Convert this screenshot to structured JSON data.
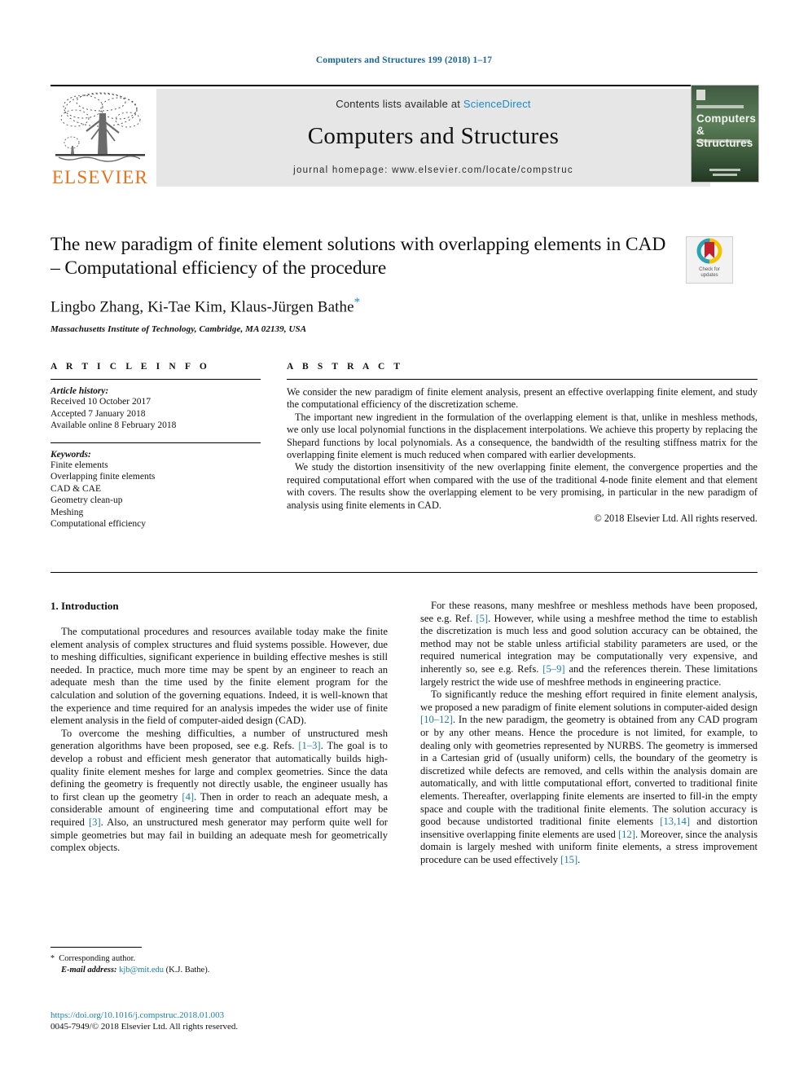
{
  "running_head": "Computers and Structures 199 (2018) 1–17",
  "masthead": {
    "contents_prefix": "Contents lists available at ",
    "sciencedirect": "ScienceDirect",
    "journal_title": "Computers and Structures",
    "homepage": "journal homepage: www.elsevier.com/locate/compstruc",
    "publisher_logo_text": "ELSEVIER",
    "cover": {
      "line1": "Computers",
      "line2": "& Structures"
    }
  },
  "title_block": {
    "title": "The new paradigm of finite element solutions with overlapping elements in CAD – Computational efficiency of the procedure",
    "authors": "Lingbo Zhang, Ki-Tae Kim, Klaus-Jürgen Bathe",
    "corresponding_marker": "*",
    "affiliation": "Massachusetts Institute of Technology, Cambridge, MA 02139, USA",
    "crossmark_label_line1": "Check for",
    "crossmark_label_line2": "updates"
  },
  "article_info": {
    "heading": "A R T I C L E   I N F O",
    "history_label": "Article history:",
    "history": [
      "Received 10 October 2017",
      "Accepted 7 January 2018",
      "Available online 8 February 2018"
    ],
    "keywords_label": "Keywords:",
    "keywords": [
      "Finite elements",
      "Overlapping finite elements",
      "CAD & CAE",
      "Geometry clean-up",
      "Meshing",
      "Computational efficiency"
    ]
  },
  "abstract": {
    "heading": "A B S T R A C T",
    "paragraphs": [
      "We consider the new paradigm of finite element analysis, present an effective overlapping finite element, and study the computational efficiency of the discretization scheme.",
      "The important new ingredient in the formulation of the overlapping element is that, unlike in meshless methods, we only use local polynomial functions in the displacement interpolations. We achieve this property by replacing the Shepard functions by local polynomials. As a consequence, the bandwidth of the resulting stiffness matrix for the overlapping finite element is much reduced when compared with earlier developments.",
      "We study the distortion insensitivity of the new overlapping finite element, the convergence properties and the required computational effort when compared with the use of the traditional 4-node finite element and that element with covers. The results show the overlapping element to be very promising, in particular in the new paradigm of analysis using finite elements in CAD."
    ],
    "copyright": "© 2018 Elsevier Ltd. All rights reserved."
  },
  "body": {
    "section_heading": "1. Introduction",
    "left_paragraphs": [
      "The computational procedures and resources available today make the finite element analysis of complex structures and fluid systems possible. However, due to meshing difficulties, significant experience in building effective meshes is still needed. In practice, much more time may be spent by an engineer to reach an adequate mesh than the time used by the finite element program for the calculation and solution of the governing equations. Indeed, it is well-known that the experience and time required for an analysis impedes the wider use of finite element analysis in the field of computer-aided design (CAD)."
    ],
    "left_paragraph_2_parts": [
      "To overcome the meshing difficulties, a number of unstructured mesh generation algorithms have been proposed, see e.g. Refs. ",
      "[1–3]",
      ". The goal is to develop a robust and efficient mesh generator that automatically builds high-quality finite element meshes for large and complex geometries. Since the data defining the geometry is frequently not directly usable, the engineer usually has to first clean up the geometry ",
      "[4]",
      ". Then in order to reach an adequate mesh, a considerable amount of engineering time and computational effort may be required ",
      "[3]",
      ". Also, an unstructured mesh generator may perform quite well for simple geometries but may fail in building an adequate mesh for geometrically complex objects."
    ],
    "right_paragraph_1_parts": [
      "For these reasons, many meshfree or meshless methods have been proposed, see e.g. Ref. ",
      "[5]",
      ". However, while using a meshfree method the time to establish the discretization is much less and good solution accuracy can be obtained, the method may not be stable unless artificial stability parameters are used, or the required numerical integration may be computationally very expensive, and inherently so, see e.g. Refs. ",
      "[5–9]",
      " and the references therein. These limitations largely restrict the wide use of meshfree methods in engineering practice."
    ],
    "right_paragraph_2_parts": [
      "To significantly reduce the meshing effort required in finite element analysis, we proposed a new paradigm of finite element solutions in computer-aided design ",
      "[10–12]",
      ". In the new paradigm, the geometry is obtained from any CAD program or by any other means. Hence the procedure is not limited, for example, to dealing only with geometries represented by NURBS. The geometry is immersed in a Cartesian grid of (usually uniform) cells, the boundary of the geometry is discretized while defects are removed, and cells within the analysis domain are automatically, and with little computational effort, converted to traditional finite elements. Thereafter, overlapping finite elements are inserted to fill-in the empty space and couple with the traditional finite elements. The solution accuracy is good because undistorted traditional finite elements ",
      "[13,14]",
      " and distortion insensitive overlapping finite elements are used ",
      "[12]",
      ". Moreover, since the analysis domain is largely meshed with uniform finite elements, a stress improvement procedure can be used effectively ",
      "[15]",
      "."
    ]
  },
  "footnote": {
    "star": "*",
    "corresponding": "Corresponding author.",
    "email_label": "E-mail address:",
    "email": "kjb@mit.edu",
    "email_owner": "(K.J. Bathe)."
  },
  "footer": {
    "doi": "https://doi.org/10.1016/j.compstruc.2018.01.003",
    "issn_copyright": "0045-7949/© 2018 Elsevier Ltd. All rights reserved."
  },
  "colors": {
    "link": "#1a7fae",
    "sciencedirect": "#1a8cc8",
    "elsevier_orange": "#E9711C",
    "banner_gray": "#e6e6e6"
  }
}
